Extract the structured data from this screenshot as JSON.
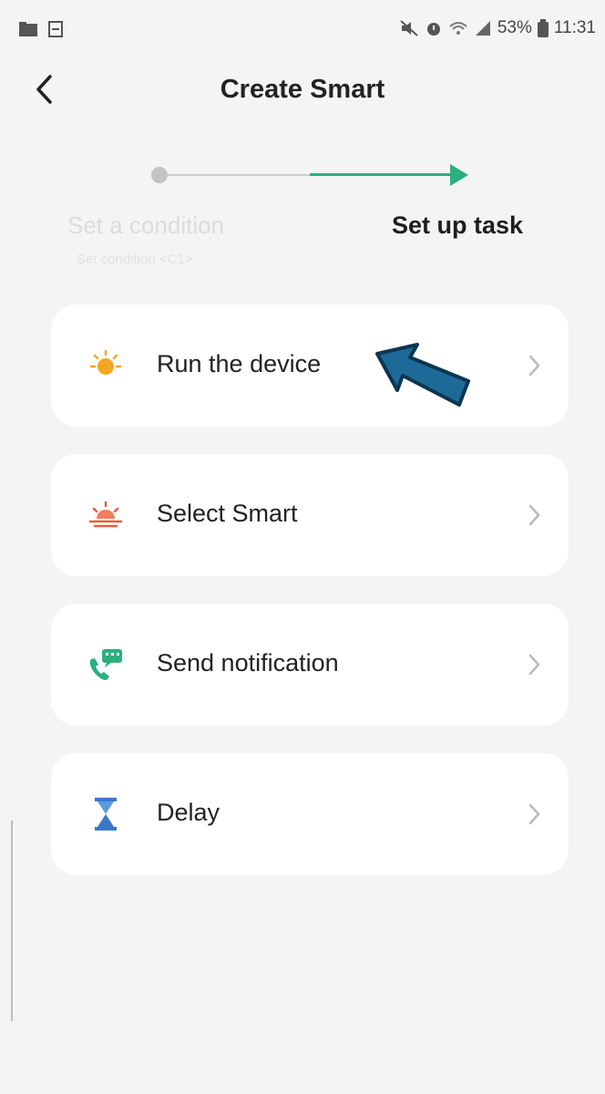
{
  "status_bar": {
    "battery": "53%",
    "time": "11:31"
  },
  "header": {
    "title": "Create Smart"
  },
  "stepper": {
    "step1_label": "Set a condition",
    "step1_sub": "Set condition <C1>",
    "step2_label": "Set up task"
  },
  "tasks": [
    {
      "label": "Run the device",
      "icon": "sun-icon",
      "color": "#f5a623"
    },
    {
      "label": "Select Smart",
      "icon": "sunrise-icon",
      "color": "#e85b3f"
    },
    {
      "label": "Send notification",
      "icon": "phone-message-icon",
      "color": "#2bb07f"
    },
    {
      "label": "Delay",
      "icon": "hourglass-icon",
      "color": "#3a78c9"
    }
  ],
  "colors": {
    "accent": "#2bb07f",
    "annotation_arrow": "#1d6a99",
    "background": "#f4f4f4"
  }
}
